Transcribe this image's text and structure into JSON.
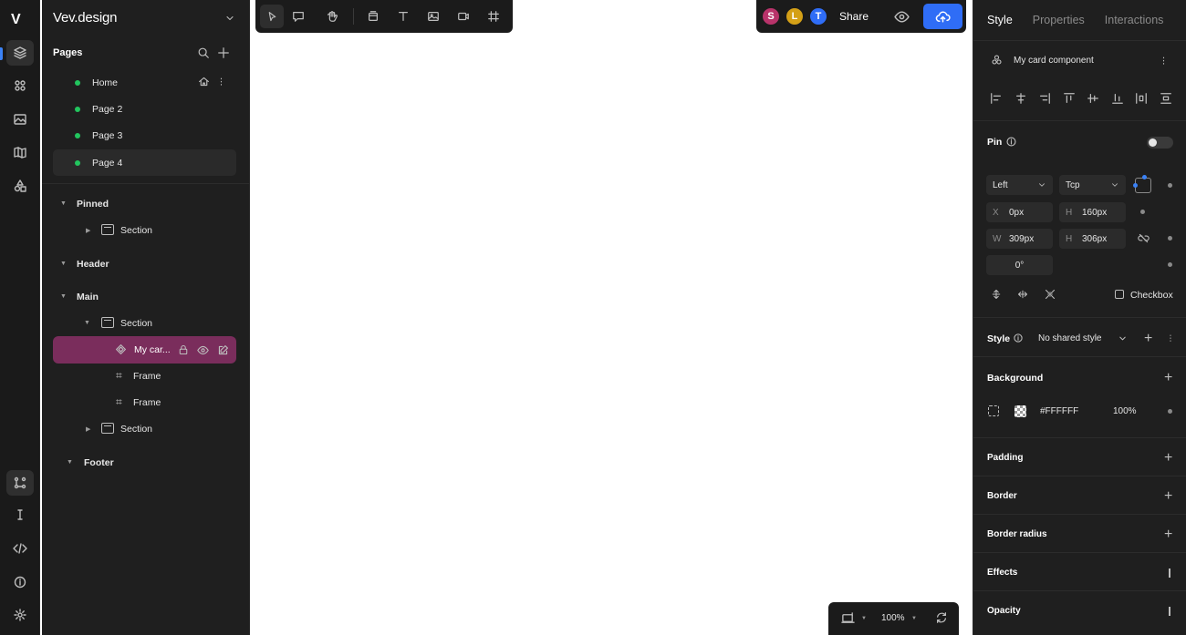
{
  "app": {
    "logo": "V",
    "project_name": "Vev.design"
  },
  "rail": {
    "items": [
      "layers-icon",
      "components-icon",
      "media-icon",
      "map-icon",
      "shapes-icon",
      "flow-icon",
      "text-cursor-icon",
      "code-icon",
      "info-icon",
      "settings-icon"
    ]
  },
  "pages": {
    "heading": "Pages",
    "items": [
      {
        "label": "Home"
      },
      {
        "label": "Page 2"
      },
      {
        "label": "Page 3"
      },
      {
        "label": "Page 4"
      }
    ]
  },
  "layers": {
    "pinned": "Pinned",
    "pinned_section": "Section",
    "header": "Header",
    "main": "Main",
    "main_section": "Section",
    "component": "My car...",
    "frame1": "Frame",
    "frame2": "Frame",
    "section3": "Section",
    "footer": "Footer"
  },
  "share": {
    "avatars": [
      {
        "letter": "S",
        "color": "#b8336a"
      },
      {
        "letter": "L",
        "color": "#d4a017"
      },
      {
        "letter": "T",
        "color": "#2f6df6"
      }
    ],
    "label": "Share"
  },
  "zoom": {
    "value": "100%"
  },
  "props": {
    "tabs": [
      "Style",
      "Properties",
      "Interactions"
    ],
    "component_name": "My card component",
    "pin_label": "Pin",
    "pin_h": "Left",
    "pin_v": "Tcp",
    "x_label": "X",
    "x_value": "0px",
    "y_label": "H",
    "y_value": "160px",
    "w_label": "W",
    "w_value": "309px",
    "h_label": "H",
    "h_value": "306px",
    "rotation": "0°",
    "checkbox_label": "Checkbox",
    "style_label": "Style",
    "shared_style": "No shared style",
    "background_label": "Background",
    "bg_color": "#FFFFFF",
    "bg_opacity": "100%",
    "padding_label": "Padding",
    "border_label": "Border",
    "border_radius_label": "Border radius",
    "effects_label": "Effects",
    "opacity_label": "Opacity"
  }
}
